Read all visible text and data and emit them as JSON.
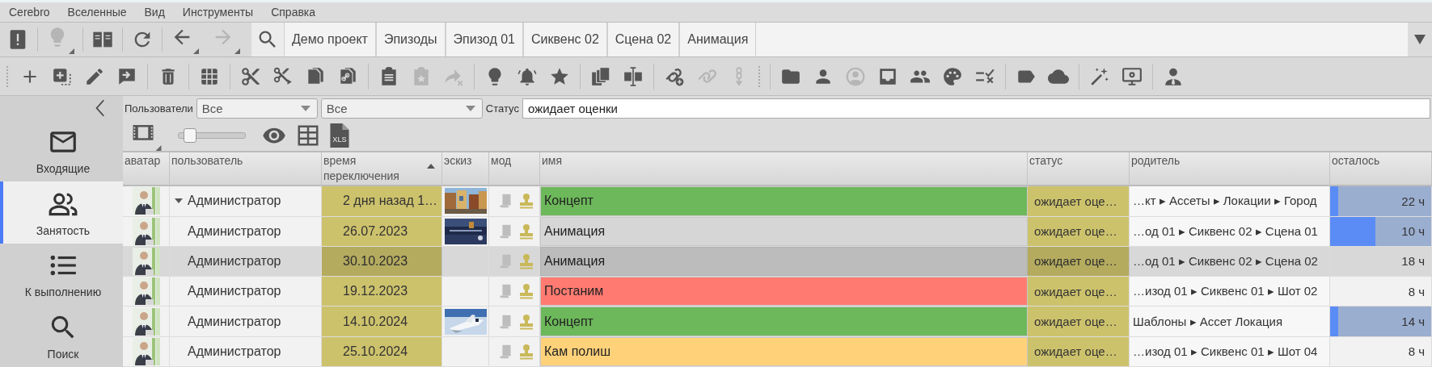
{
  "menu": [
    "Cerebro",
    "Вселенные",
    "Вид",
    "Инструменты",
    "Справка"
  ],
  "nav_buttons": [
    {
      "disabled": false
    },
    {
      "disabled": true
    },
    {
      "disabled": false
    },
    {
      "disabled": false
    },
    {
      "disabled": false
    },
    {
      "disabled": true
    },
    {
      "disabled": false
    }
  ],
  "breadcrumbs": [
    "Демо проект",
    "Эпизоды",
    "Эпизод 01",
    "Сиквенс 02",
    "Сцена 02",
    "Анимация"
  ],
  "toolbar": [
    [
      {
        "disabled": false
      },
      {
        "disabled": false
      },
      {
        "disabled": false
      },
      {
        "disabled": false
      }
    ],
    [
      {
        "disabled": false
      }
    ],
    [
      {
        "disabled": false
      }
    ],
    [
      {
        "disabled": false
      },
      {
        "disabled": false
      },
      {
        "disabled": false
      },
      {
        "disabled": false
      }
    ],
    [
      {
        "disabled": false
      },
      {
        "disabled": true
      },
      {
        "disabled": true
      }
    ],
    [
      {
        "disabled": false
      },
      {
        "disabled": false
      },
      {
        "disabled": false
      }
    ],
    [
      {
        "disabled": false
      },
      {
        "disabled": false
      }
    ],
    [
      {
        "disabled": false
      },
      {
        "disabled": true
      },
      {
        "disabled": true
      }
    ],
    [
      {
        "disabled": false
      },
      {
        "disabled": false
      },
      {
        "disabled": true
      },
      {
        "disabled": false
      },
      {
        "disabled": false
      },
      {
        "disabled": false
      },
      {
        "disabled": false
      }
    ],
    [
      {
        "disabled": false
      },
      {
        "disabled": false
      }
    ],
    [
      {
        "disabled": false
      },
      {
        "disabled": false
      }
    ],
    [
      {
        "disabled": false
      }
    ]
  ],
  "sidebar": {
    "items": [
      {
        "label": "Входящие",
        "selected": false
      },
      {
        "label": "Занятость",
        "selected": true
      },
      {
        "label": "К выполнению",
        "selected": false
      },
      {
        "label": "Поиск",
        "selected": false
      }
    ]
  },
  "filters": {
    "users_label": "Пользователи",
    "users_value": "Все",
    "group_value": "Все",
    "status_label": "Статус",
    "status_value": "ожидает оценки"
  },
  "thumb_slider": {
    "level": 0.15
  },
  "export_label": "XLS",
  "table": {
    "columns": [
      {
        "label": "аватар",
        "sorted": false
      },
      {
        "label": "пользователь",
        "sorted": false
      },
      {
        "label": "время переключения",
        "sorted": true
      },
      {
        "label": "эскиз",
        "sorted": false
      },
      {
        "label": "мод",
        "sorted": false
      },
      {
        "label": "имя",
        "sorted": false
      },
      {
        "label": "статус",
        "sorted": false
      },
      {
        "label": "родитель",
        "sorted": false
      },
      {
        "label": "осталось",
        "sorted": false
      }
    ],
    "rows": [
      {
        "user": "Администратор",
        "time": "2 дня назад 1…",
        "sketch": {
          "kind": "picture"
        },
        "name": "Концепт",
        "color": "#6cb85a",
        "status": "ожидает оце…",
        "parent": "…кт ▸ Ассеты ▸ Локации ▸ Город",
        "remaining": "22 ч",
        "level": 0.08,
        "selected": false,
        "expanded": true,
        "children": [
          {
            "user": "Администратор",
            "time": "26.07.2023",
            "sketch": {
              "kind": "picture"
            },
            "name": "Анимация",
            "color": "#d6d6d6",
            "status": "ожидает оце…",
            "parent": "…од 01 ▸ Сиквенс 02 ▸ Сцена 01",
            "remaining": "10 ч",
            "level": 0.45,
            "selected": false
          },
          {
            "user": "Администратор",
            "time": "30.10.2023",
            "name": "Анимация",
            "color": "#d6d6d6",
            "status": "ожидает оце…",
            "parent": "…од 01 ▸ Сиквенс 02 ▸ Сцена 02",
            "remaining": "18 ч",
            "selected": true
          },
          {
            "user": "Администратор",
            "time": "19.12.2023",
            "name": "Постаним",
            "color": "#ff7b72",
            "status": "ожидает оце…",
            "parent": "…изод 01 ▸ Сиквенс 01 ▸ Шот 02",
            "remaining": "8 ч",
            "selected": false
          },
          {
            "user": "Администратор",
            "time": "14.10.2024",
            "sketch": {
              "kind": "picture"
            },
            "name": "Концепт",
            "color": "#6cb85a",
            "status": "ожидает оце…",
            "parent": "Шаблоны ▸ Ассет Локация",
            "remaining": "14 ч",
            "level": 0.08,
            "selected": false
          },
          {
            "user": "Администратор",
            "time": "25.10.2024",
            "name": "Кам полиш",
            "color": "#ffd27a",
            "status": "ожидает оце…",
            "parent": "…изод 01 ▸ Сиквенс 01 ▸ Шот 04",
            "remaining": "8 ч",
            "selected": false
          }
        ]
      }
    ]
  }
}
